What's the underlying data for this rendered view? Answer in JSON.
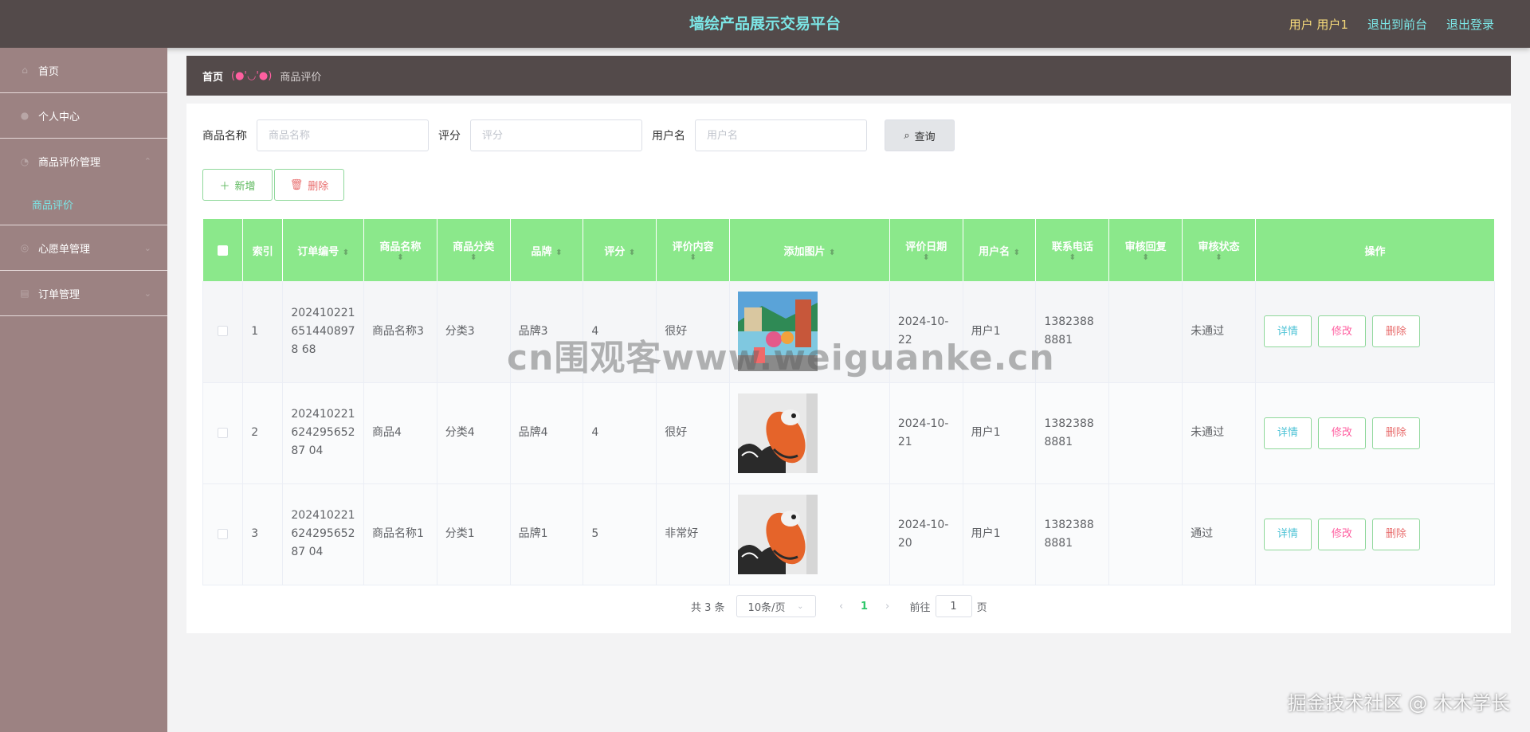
{
  "header": {
    "title": "墙绘产品展示交易平台",
    "user": "用户 用户1",
    "to_front": "退出到前台",
    "logout": "退出登录"
  },
  "sidebar": {
    "items": [
      {
        "label": "首页",
        "icon": "home-icon"
      },
      {
        "label": "个人中心",
        "icon": "user-icon"
      },
      {
        "label": "商品评价管理",
        "icon": "review-icon"
      },
      {
        "label": "心愿单管理",
        "icon": "wishlist-icon"
      },
      {
        "label": "订单管理",
        "icon": "order-icon"
      }
    ],
    "active_sub": "商品评价"
  },
  "breadcrumb": {
    "home": "首页",
    "separator": "(●'◡'●)",
    "current": "商品评价"
  },
  "search": {
    "product_label": "商品名称",
    "product_placeholder": "商品名称",
    "score_label": "评分",
    "score_placeholder": "评分",
    "username_label": "用户名",
    "username_placeholder": "用户名",
    "query_button": "查询"
  },
  "actions": {
    "add": "新增",
    "delete": "删除"
  },
  "table": {
    "headers": [
      "索引",
      "订单编号",
      "商品名称",
      "商品分类",
      "品牌",
      "评分",
      "评价内容",
      "添加图片",
      "评价日期",
      "用户名",
      "联系电话",
      "审核回复",
      "审核状态",
      "操作"
    ],
    "rows": [
      {
        "index": "1",
        "order_no": "2024102216514408978 68",
        "product": "商品名称3",
        "category": "分类3",
        "brand": "品牌3",
        "score": "4",
        "content": "很好",
        "date": "2024-10-22",
        "username": "用户1",
        "phone": "13823888881",
        "reply": "",
        "status": "未通过",
        "image": "mural-street-photo"
      },
      {
        "index": "2",
        "order_no": "20241022162429565287 04",
        "product": "商品4",
        "category": "分类4",
        "brand": "品牌4",
        "score": "4",
        "content": "很好",
        "date": "2024-10-21",
        "username": "用户1",
        "phone": "13823888881",
        "reply": "",
        "status": "未通过",
        "image": "koi-wave-mural-photo"
      },
      {
        "index": "3",
        "order_no": "20241022162429565287 04",
        "product": "商品名称1",
        "category": "分类1",
        "brand": "品牌1",
        "score": "5",
        "content": "非常好",
        "date": "2024-10-20",
        "username": "用户1",
        "phone": "13823888881",
        "reply": "",
        "status": "通过",
        "image": "koi-wave-mural-photo"
      }
    ],
    "row_buttons": {
      "detail": "详情",
      "edit": "修改",
      "delete": "删除"
    }
  },
  "pagination": {
    "total": "共 3 条",
    "page_size": "10条/页",
    "current_page": "1",
    "goto_label": "前往",
    "goto_value": "1",
    "page_suffix": "页"
  },
  "watermarks": {
    "center": "cn围观客www.weiguanke.cn",
    "corner": "掘金技术社区 @ 木木学长"
  }
}
